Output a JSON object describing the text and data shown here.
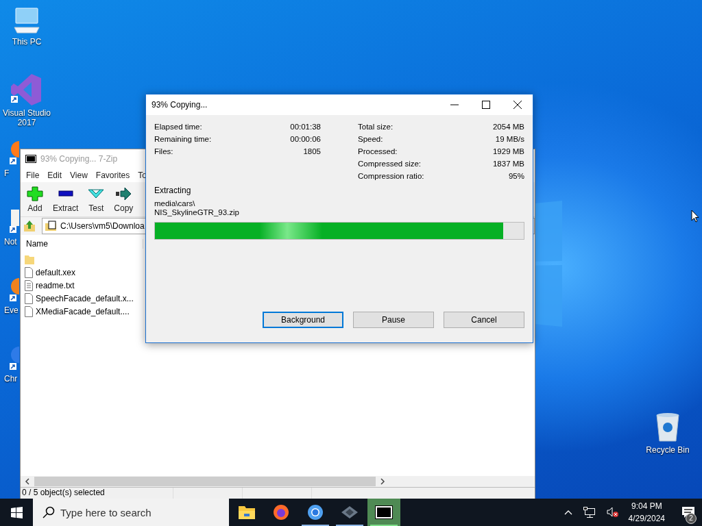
{
  "desktop": {
    "icons": [
      {
        "label": "This PC",
        "kind": "pc"
      },
      {
        "label": "Visual Studio 2017",
        "kind": "vs"
      }
    ],
    "covered_icons": [
      {
        "label": "F",
        "kind": "firefox"
      },
      {
        "label": "Not",
        "kind": "notepad"
      },
      {
        "label": "Eve",
        "kind": "app"
      },
      {
        "label": "Chr",
        "kind": "chrome"
      }
    ],
    "recycle_bin": {
      "label": "Recycle Bin"
    }
  },
  "archive_window": {
    "title": "93% Copying... 7-Zip",
    "menu": [
      "File",
      "Edit",
      "View",
      "Favorites",
      "To"
    ],
    "toolbar": [
      {
        "label": "Add",
        "kind": "add"
      },
      {
        "label": "Extract",
        "kind": "extract"
      },
      {
        "label": "Test",
        "kind": "test"
      },
      {
        "label": "Copy",
        "kind": "copy"
      }
    ],
    "address": "C:\\Users\\vm5\\Downloa",
    "columns": [
      "Name"
    ],
    "rows": [
      {
        "kind": "folder"
      },
      {
        "name": "default.xex",
        "kind": "file"
      },
      {
        "name": "readme.txt",
        "kind": "text"
      },
      {
        "name": "SpeechFacade_default.x...",
        "kind": "file"
      },
      {
        "name": "XMediaFacade_default....",
        "kind": "file"
      }
    ],
    "status": "0 / 5 object(s) selected"
  },
  "progress_dialog": {
    "title": "93% Copying...",
    "left_stats": [
      {
        "label": "Elapsed time:",
        "value": "00:01:38"
      },
      {
        "label": "Remaining time:",
        "value": "00:00:06"
      },
      {
        "label": "Files:",
        "value": "1805"
      }
    ],
    "right_stats": [
      {
        "label": "Total size:",
        "value": "2054 MB"
      },
      {
        "label": "Speed:",
        "value": "19 MB/s"
      },
      {
        "label": "Processed:",
        "value": "1929 MB"
      },
      {
        "label": "Compressed size:",
        "value": "1837 MB"
      },
      {
        "label": "Compression ratio:",
        "value": "95%"
      }
    ],
    "operation": "Extracting",
    "path": [
      "media\\cars\\",
      "NIS_SkylineGTR_93.zip"
    ],
    "progress": {
      "level": 0.944
    },
    "buttons": [
      {
        "label": "Background",
        "focused": true
      },
      {
        "label": "Pause",
        "focused": false
      },
      {
        "label": "Cancel",
        "focused": false
      }
    ]
  },
  "taskbar": {
    "search": {
      "placeholder": "Type here to search"
    },
    "apps": [
      {
        "kind": "explorer",
        "running": false,
        "selected": false
      },
      {
        "kind": "firefox",
        "running": false,
        "selected": false
      },
      {
        "kind": "chrome",
        "running": true,
        "selected": false
      },
      {
        "kind": "app",
        "running": true,
        "selected": false
      },
      {
        "kind": "sevenzip",
        "running": true,
        "selected": true
      }
    ],
    "tray": {
      "volume_muted": true,
      "time": "9:04 PM",
      "date": "4/29/2024",
      "notifications": "2"
    }
  }
}
